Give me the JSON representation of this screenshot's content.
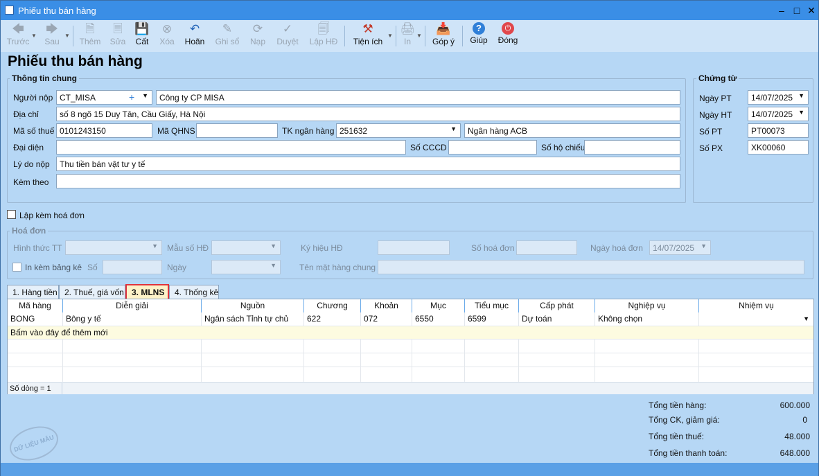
{
  "window": {
    "title": "Phiếu thu bán hàng"
  },
  "toolbar": {
    "prev": "Trước",
    "next": "Sau",
    "add": "Thêm",
    "edit": "Sửa",
    "save": "Cất",
    "delete": "Xóa",
    "undo": "Hoãn",
    "post": "Ghi sổ",
    "reload": "Nạp",
    "approve": "Duyệt",
    "invoice": "Lập HĐ",
    "utilities": "Tiện ích",
    "print": "In",
    "feedback": "Góp ý",
    "help": "Giúp",
    "close": "Đóng"
  },
  "page_title": "Phiếu thu bán hàng",
  "general": {
    "legend": "Thông tin chung",
    "payer_label": "Người nộp",
    "payer_code": "CT_MISA",
    "payer_name": "Công ty CP MISA",
    "address_label": "Địa chỉ",
    "address": "số 8 ngõ 15 Duy Tân, Cầu Giấy, Hà Nội",
    "tax_label": "Mã số thuế",
    "tax_code": "0101243150",
    "qhns_label": "Mã QHNS",
    "qhns": "",
    "bank_acc_label": "TK ngân hàng",
    "bank_acc": "251632",
    "bank_name": "Ngân hàng ACB",
    "rep_label": "Đại diện",
    "rep": "",
    "cccd_label": "Số CCCD",
    "cccd": "",
    "passport_label": "Số hộ chiếu",
    "passport": "",
    "reason_label": "Lý do nộp",
    "reason": "Thu tiền bán vật tư y tế",
    "attach_label": "Kèm theo",
    "attach": ""
  },
  "voucher": {
    "legend": "Chứng từ",
    "date_pt_label": "Ngày PT",
    "date_pt": "14/07/2025",
    "date_ht_label": "Ngày HT",
    "date_ht": "14/07/2025",
    "no_pt_label": "Số PT",
    "no_pt": "PT00073",
    "no_px_label": "Số PX",
    "no_px": "XK00060"
  },
  "with_invoice": {
    "label": "Lập kèm hoá đơn",
    "checked": false
  },
  "invoice": {
    "legend": "Hoá đơn",
    "payment_method_label": "Hình thức TT",
    "template_label": "Mẫu số HĐ",
    "symbol_label": "Ký hiệu HĐ",
    "number_label": "Số hoá đơn",
    "date_label": "Ngày hoá đơn",
    "date": "14/07/2025",
    "print_list_label": "In kèm bảng kê",
    "no_label": "Số",
    "day_label": "Ngày",
    "item_name_label": "Tên mặt hàng chung"
  },
  "tabs": [
    "1. Hàng tiền",
    "2. Thuế, giá vốn",
    "3. MLNS",
    "4. Thống kê"
  ],
  "grid": {
    "columns": [
      "Mã hàng",
      "Diễn giải",
      "Nguồn",
      "Chương",
      "Khoản",
      "Mục",
      "Tiểu mục",
      "Cấp phát",
      "Nghiệp vụ",
      "Nhiệm vụ"
    ],
    "rows": [
      [
        "BONG",
        "Bông y tế",
        "Ngân sách Tỉnh tự chủ",
        "622",
        "072",
        "6550",
        "6599",
        "Dự toán",
        "Không chọn",
        ""
      ]
    ],
    "add_hint": "Bấm vào đây để thêm mới",
    "row_count": "Số dòng = 1"
  },
  "totals": {
    "goods_label": "Tổng tiền hàng:",
    "goods": "600.000",
    "discount_label": "Tổng CK, giảm giá:",
    "discount": "0",
    "tax_label": "Tổng tiền thuế:",
    "tax": "48.000",
    "payment_label": "Tổng tiền thanh toán:",
    "payment": "648.000"
  },
  "stamp": "DỮ LIỆU MẪU"
}
